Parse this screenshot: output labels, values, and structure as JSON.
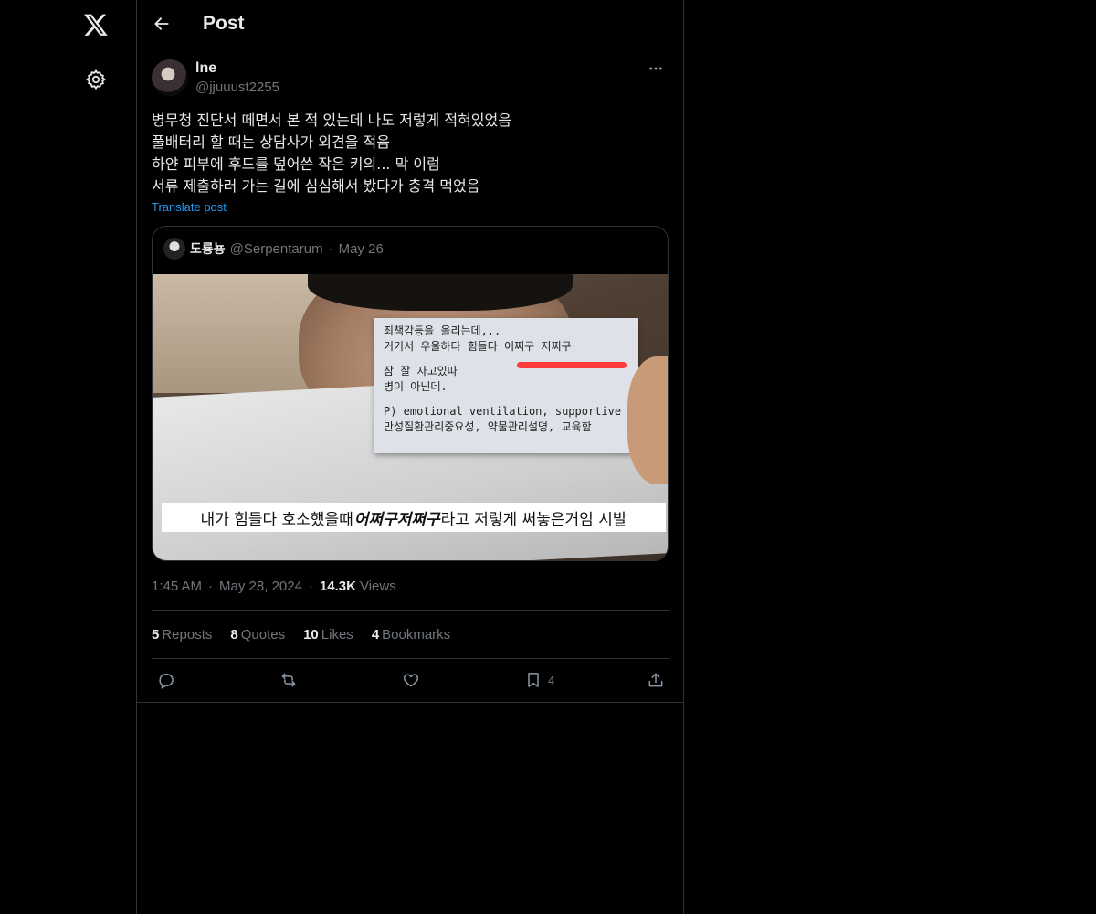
{
  "header": {
    "title": "Post"
  },
  "icons": {
    "x_logo": "x-logo-icon",
    "settings": "gear-icon",
    "back": "arrow-left-icon",
    "more": "more-horizontal-icon",
    "reply": "reply-icon",
    "repost": "repost-icon",
    "like": "heart-icon",
    "bookmark": "bookmark-icon",
    "share": "share-icon"
  },
  "post": {
    "author_name": "lne",
    "author_handle": "@jjuuust2255",
    "lines": [
      "병무청 진단서 떼면서 본 적 있는데 나도 저렇게 적혀있었음",
      "풀배터리 할 때는 상담사가 외견을 적음",
      "하얀 피부에 후드를 덮어쓴 작은 키의... 막 이럼",
      "서류 제출하러 가는 길에 심심해서 봤다가 충격 먹었음"
    ],
    "translate_label": "Translate post",
    "time": "1:45 AM",
    "date": "May 28, 2024",
    "views_count": "14.3K",
    "views_label": "Views"
  },
  "quote": {
    "author_name": "도룡뇽",
    "author_handle": "@Serpentarum",
    "date": "May 26",
    "media": {
      "note_lines": [
        "죄책감등을 올리는데,..",
        "거기서 우울하다 힘들다 어쩌구 저쩌구",
        "",
        "잠 잘 자고있따",
        "병이 아닌데.",
        "",
        "P) emotional ventilation, supportive P",
        "만성질환관리중요성, 약물관리설명, 교육함"
      ],
      "caption_before": "내가 힘들다 호소했을때 ",
      "caption_highlight": "어쩌구저쩌구",
      "caption_after": "라고 저렇게 써놓은거임 시발"
    }
  },
  "stats": {
    "reposts_count": "5",
    "reposts_label": "Reposts",
    "quotes_count": "8",
    "quotes_label": "Quotes",
    "likes_count": "10",
    "likes_label": "Likes",
    "bookmarks_count": "4",
    "bookmarks_label": "Bookmarks"
  },
  "actions": {
    "bookmark_count": "4"
  }
}
